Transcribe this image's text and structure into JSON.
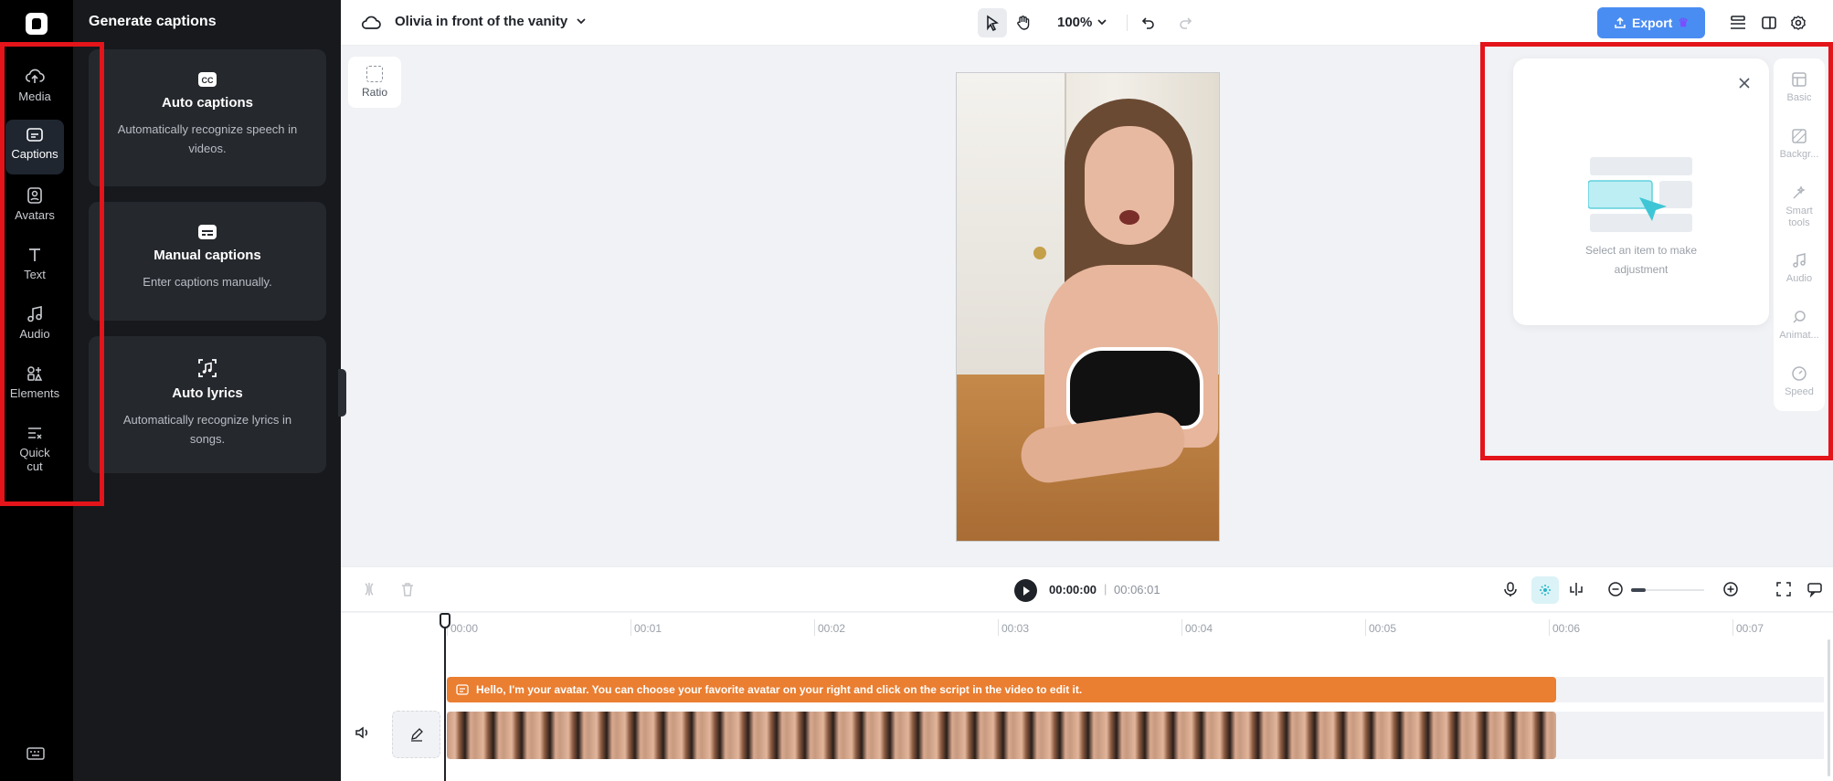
{
  "rail": {
    "items": [
      {
        "label": "Media",
        "icon": "cloud-upload-icon"
      },
      {
        "label": "Captions",
        "icon": "captions-icon"
      },
      {
        "label": "Avatars",
        "icon": "avatar-icon"
      },
      {
        "label": "Text",
        "icon": "text-icon"
      },
      {
        "label": "Audio",
        "icon": "music-note-icon"
      },
      {
        "label": "Elements",
        "icon": "elements-icon"
      },
      {
        "label": "Quick cut",
        "icon": "quick-cut-icon"
      }
    ],
    "active": "Captions"
  },
  "panel": {
    "title": "Generate captions",
    "cards": [
      {
        "title": "Auto captions",
        "description": "Automatically recognize speech in videos.",
        "icon": "cc-icon"
      },
      {
        "title": "Manual captions",
        "description": "Enter captions manually.",
        "icon": "subtitle-icon"
      },
      {
        "title": "Auto lyrics",
        "description": "Automatically recognize lyrics in songs.",
        "icon": "lyrics-icon"
      }
    ]
  },
  "topbar": {
    "project_title": "Olivia in front of the vanity",
    "zoom": "100%",
    "export_label": "Export"
  },
  "canvas": {
    "ratio_label": "Ratio"
  },
  "properties": {
    "empty_message": "Select an item to make adjustment",
    "tabs": [
      "Basic",
      "Backgr...",
      "Smart tools",
      "Audio",
      "Animat...",
      "Speed"
    ]
  },
  "playback": {
    "current_time": "00:00:00",
    "separator": "|",
    "duration": "00:06:01"
  },
  "timeline": {
    "ticks": [
      "00:00",
      "00:01",
      "00:02",
      "00:03",
      "00:04",
      "00:05",
      "00:06",
      "00:07"
    ],
    "script_text": "Hello, I'm your avatar. You can choose your favorite avatar on your right and click on the script in the video to edit it."
  },
  "colors": {
    "accent": "#4a8df2",
    "script_clip": "#ea7e31",
    "annotation": "#e3141a"
  }
}
